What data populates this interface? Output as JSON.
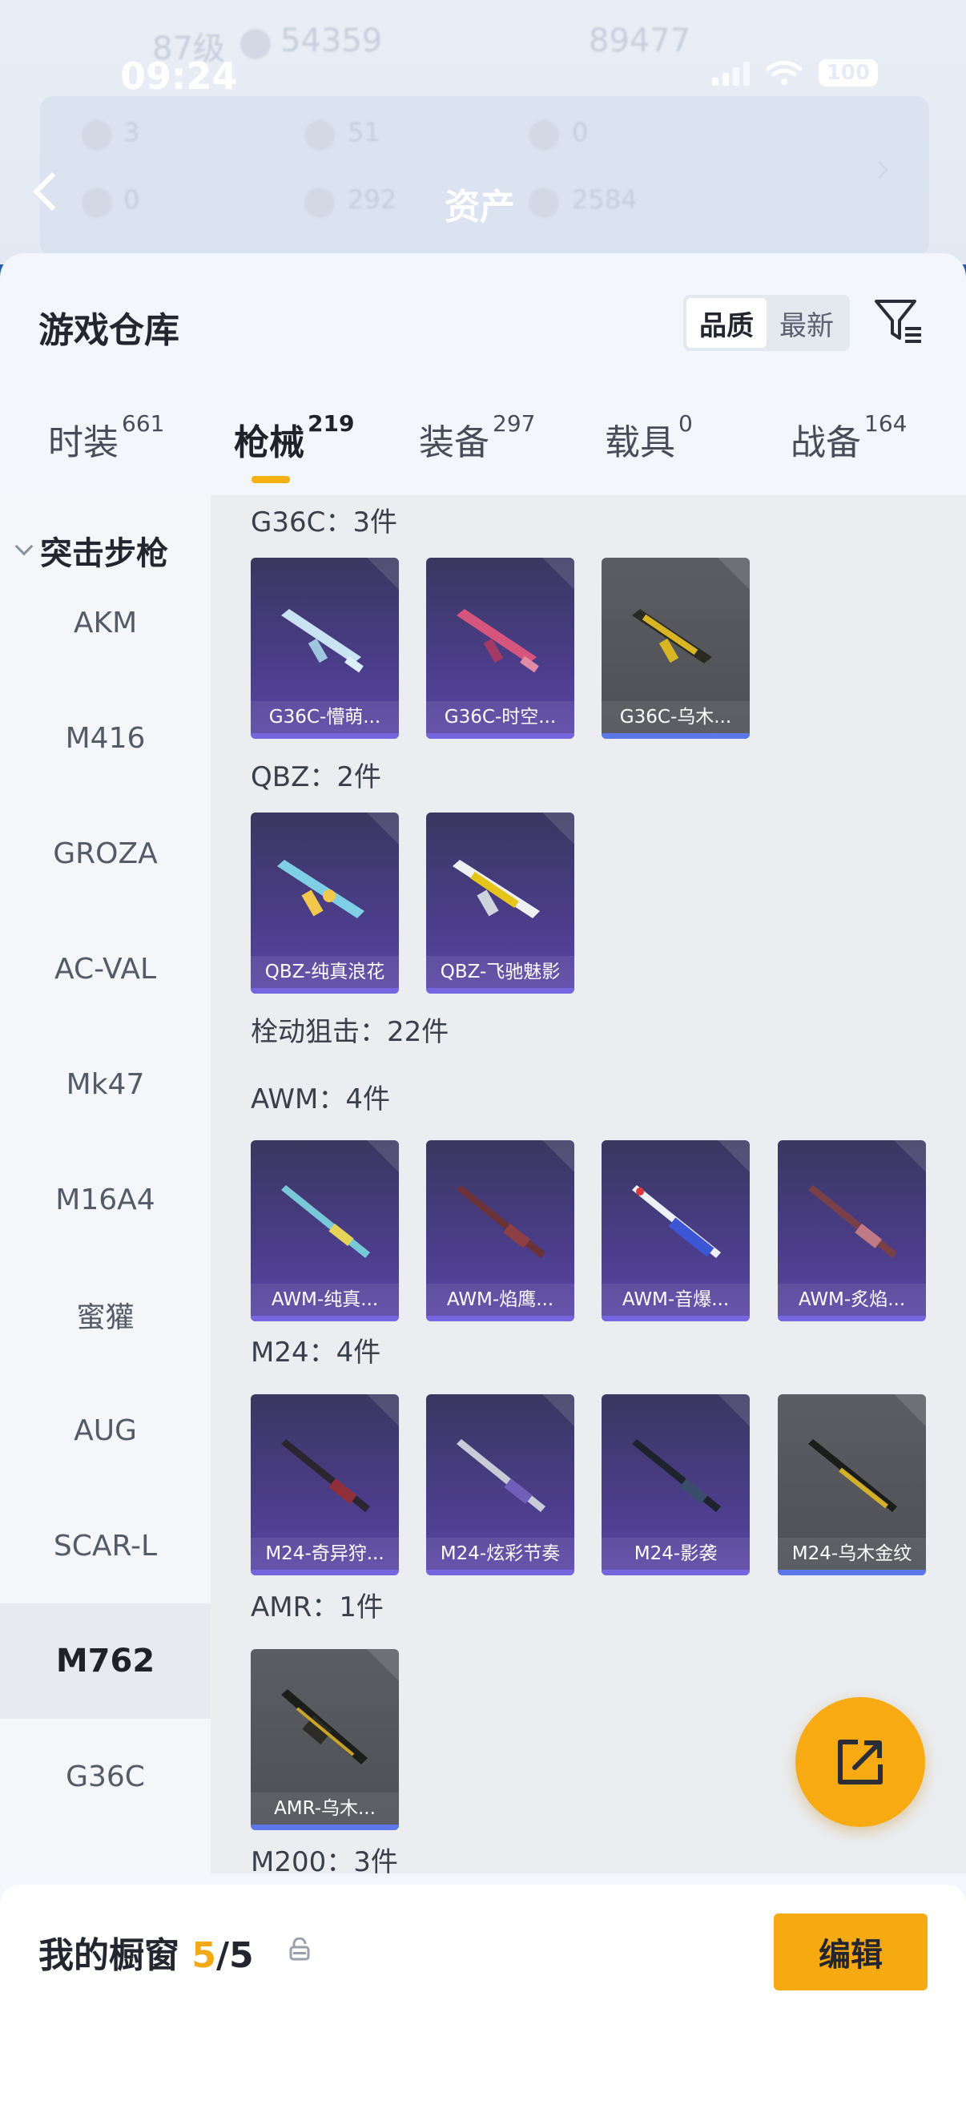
{
  "status_bar": {
    "time": "09:24",
    "battery": "100"
  },
  "background_header": {
    "level": "87级",
    "coins": "54359",
    "points": "89477",
    "stats": [
      "3",
      "51",
      "0",
      "0",
      "292",
      "2584"
    ],
    "title": "资产"
  },
  "warehouse": {
    "title": "游戏仓库",
    "sort_options": [
      "品质",
      "最新"
    ],
    "active_sort": "品质"
  },
  "tabs": [
    {
      "label": "时装",
      "count": "661"
    },
    {
      "label": "枪械",
      "count": "219"
    },
    {
      "label": "装备",
      "count": "297"
    },
    {
      "label": "载具",
      "count": "0"
    },
    {
      "label": "战备",
      "count": "164"
    }
  ],
  "active_tab": "枪械",
  "sidebar": {
    "category": "突击步枪",
    "items": [
      "AKM",
      "M416",
      "GROZA",
      "AC-VAL",
      "Mk47",
      "M16A4",
      "蜜獾",
      "AUG",
      "SCAR-L",
      "M762",
      "G36C"
    ],
    "active": "M762"
  },
  "sections": {
    "g36c": {
      "label": "G36C：3件",
      "items": [
        "G36C-懵萌...",
        "G36C-时空...",
        "G36C-乌木..."
      ]
    },
    "qbz": {
      "label": "QBZ：2件",
      "items": [
        "QBZ-纯真浪花",
        "QBZ-飞驰魅影"
      ]
    },
    "bolt": {
      "label": "栓动狙击：22件"
    },
    "awm": {
      "label": "AWM：4件",
      "items": [
        "AWM-纯真...",
        "AWM-焰鹰...",
        "AWM-音爆...",
        "AWM-炙焰..."
      ]
    },
    "m24": {
      "label": "M24：4件",
      "items": [
        "M24-奇异狩...",
        "M24-炫彩节奏",
        "M24-影袭",
        "M24-乌木金纹"
      ]
    },
    "amr": {
      "label": "AMR：1件",
      "items": [
        "AMR-乌木..."
      ]
    },
    "m200": {
      "label": "M200：3件"
    }
  },
  "showcase": {
    "title": "我的橱窗",
    "current": "5",
    "separator": "/",
    "total": "5",
    "edit_label": "编辑"
  },
  "colors": {
    "accent": "#f6aa12",
    "card_purple": "#4b3d8a",
    "card_grey": "#55575d"
  }
}
